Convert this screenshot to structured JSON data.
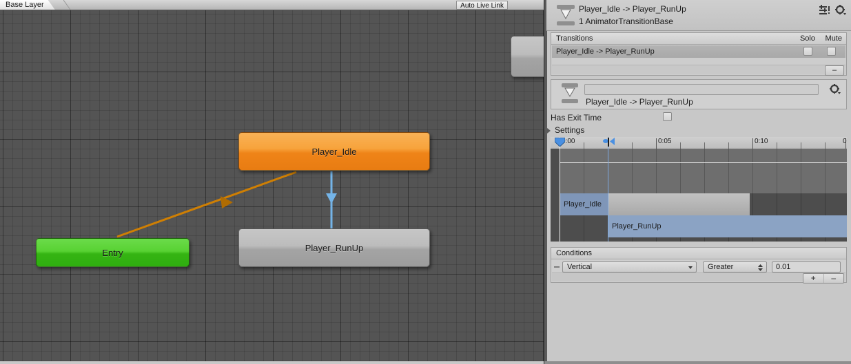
{
  "graph": {
    "breadcrumb": "Base Layer",
    "auto_live_link": "Auto Live Link",
    "nodes": [
      {
        "name": "Player_Idle",
        "kind": "state",
        "color": "#ef8418"
      },
      {
        "name": "Player_RunUp",
        "kind": "state",
        "color": "#a4a4a4"
      },
      {
        "name": "Entry",
        "kind": "entry",
        "color": "#35b413"
      }
    ],
    "edges": [
      {
        "from": "Entry",
        "to": "Player_Idle",
        "color": "#d58100"
      },
      {
        "from": "Player_Idle",
        "to": "Player_RunUp",
        "color": "#74b4e8"
      }
    ]
  },
  "inspector": {
    "title": "Player_Idle -> Player_RunUp",
    "subtitle": "1 AnimatorTransitionBase",
    "header_icons": [
      "preset-icon",
      "gear-icon"
    ],
    "transitions": {
      "header_label": "Transitions",
      "solo_label": "Solo",
      "mute_label": "Mute",
      "rows": [
        {
          "label": "Player_Idle -> Player_RunUp",
          "solo": false,
          "mute": false
        }
      ],
      "remove_label": "–"
    },
    "transition_card": {
      "name_value": "",
      "name_placeholder": "",
      "subtitle": "Player_Idle -> Player_RunUp",
      "gear_icon": "gear-icon"
    },
    "has_exit_time": {
      "label": "Has Exit Time",
      "checked": false
    },
    "settings": {
      "label": "Settings",
      "expanded": false
    },
    "timeline": {
      "ruler_labels": [
        "0:00",
        "0:05",
        "0:10",
        "0"
      ],
      "clips": [
        {
          "label": "Player_Idle",
          "track": 0
        },
        {
          "label": "Player_RunUp",
          "track": 1
        }
      ]
    },
    "conditions": {
      "header_label": "Conditions",
      "rows": [
        {
          "parameter": "Vertical",
          "operator": "Greater",
          "value": "0.01"
        }
      ],
      "add_label": "+",
      "remove_label": "–"
    }
  }
}
